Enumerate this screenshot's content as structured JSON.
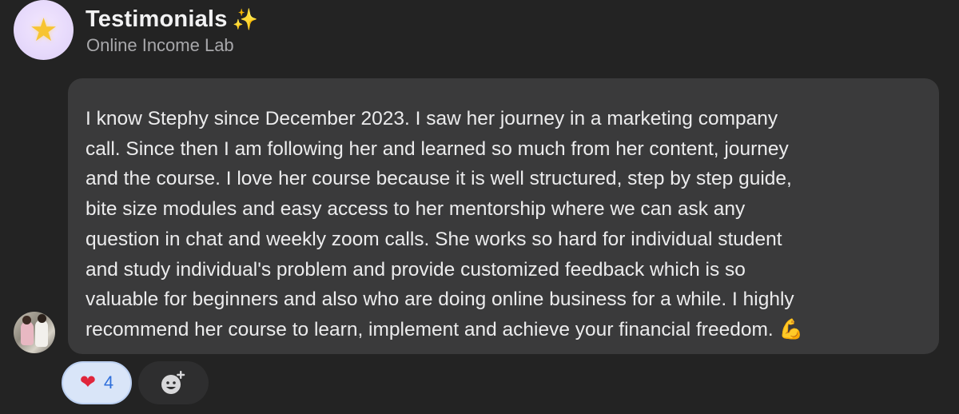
{
  "header": {
    "title": "Testimonials",
    "title_emoji": "✨",
    "subtitle": "Online Income Lab",
    "avatar_icon": "star-emoji"
  },
  "message": {
    "lines": [
      "I know Stephy since  December 2023. I saw her journey in a marketing company",
      "call. Since then I am following her and learned so much from her content, journey",
      "and the course. I love her course because it is well structured, step by step guide,",
      "bite size modules and easy access to her mentorship where we can ask any",
      "question in chat and weekly zoom calls. She works so hard for individual student",
      "and study individual's problem and provide customized feedback which is so",
      "valuable for beginners and also who are doing online business for a while. I highly",
      "recommend her course to learn, implement and achieve your financial freedom."
    ],
    "trailing_emoji": "💪"
  },
  "reactions": {
    "heart": {
      "emoji": "❤",
      "count": "4"
    },
    "add_reaction_icon": "add-emoji-icon"
  },
  "colors": {
    "background": "#232323",
    "bubble": "#3a3a3b",
    "reaction_bg": "#d9e5f8",
    "reaction_count": "#2f6fdb"
  }
}
